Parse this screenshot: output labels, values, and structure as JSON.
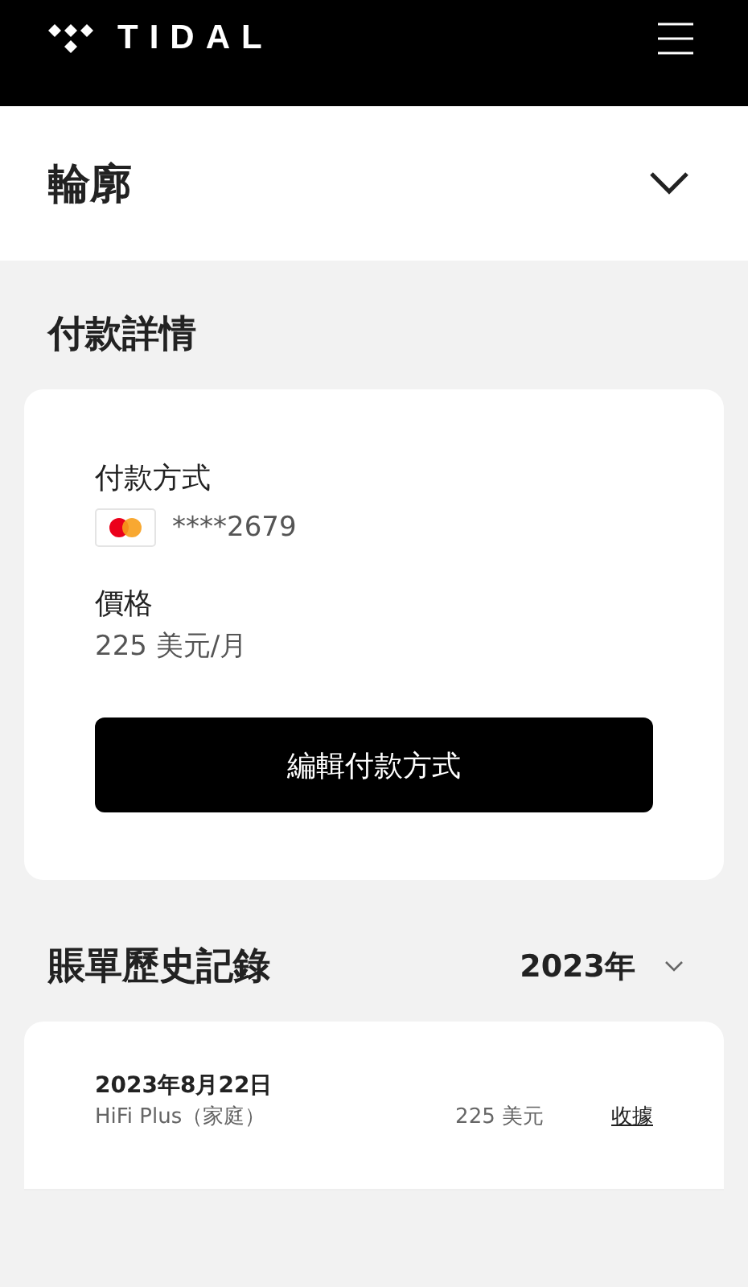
{
  "header": {
    "logo_text": "TIDAL"
  },
  "profile_section": {
    "title": "輪廓",
    "expanded": false
  },
  "payment": {
    "heading": "付款詳情",
    "method_label": "付款方式",
    "card_number": "****2679",
    "price_label": "價格",
    "price": "225 美元/月",
    "edit_button": "編輯付款方式"
  },
  "billing": {
    "heading": "賬單歷史記錄",
    "year": "2023年",
    "rows": [
      {
        "date": "2023年8月22日",
        "plan": "HiFi Plus（家庭）",
        "amount": "225 美元",
        "receipt": "收據"
      }
    ]
  }
}
